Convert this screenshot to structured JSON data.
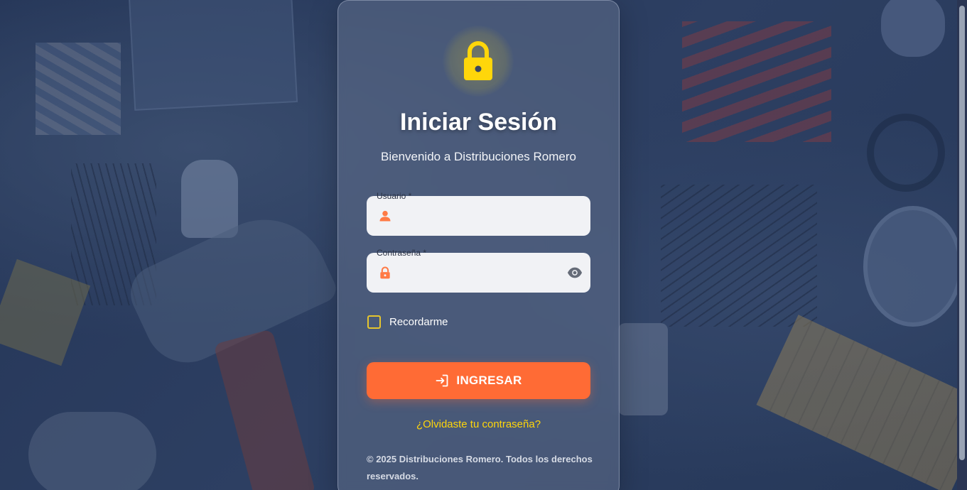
{
  "login": {
    "title": "Iniciar Sesión",
    "subtitle": "Bienvenido a Distribuciones Romero",
    "username_label": "Usuario *",
    "username_value": "",
    "password_label": "Contraseña *",
    "password_value": "",
    "remember_label": "Recordarme",
    "remember_checked": false,
    "submit_label": "INGRESAR",
    "forgot_link": "¿Olvidaste tu contraseña?",
    "footer": "© 2025 Distribuciones Romero. Todos los derechos reservados."
  },
  "icons": {
    "badge": "lock-icon",
    "username": "person-icon",
    "password": "lock-icon",
    "toggle": "eye-icon",
    "submit": "login-icon"
  },
  "colors": {
    "accent": "#ff6b35",
    "highlight": "#ffd60a",
    "checkbox_border": "#e5c52e",
    "field_bg": "#f1f2f5"
  }
}
